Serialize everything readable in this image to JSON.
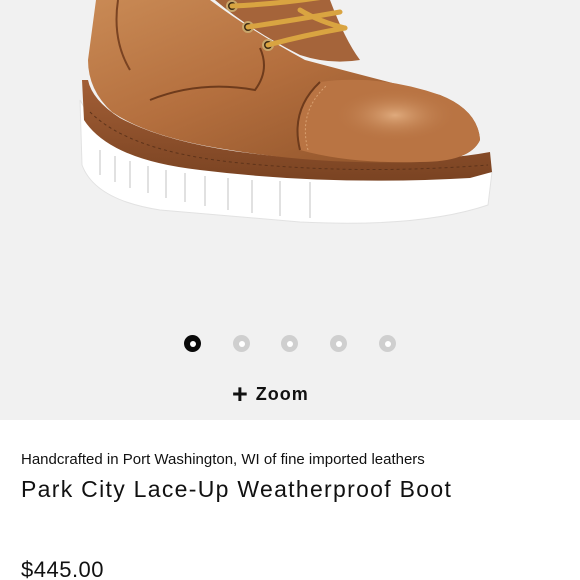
{
  "gallery": {
    "image_alt": "Park City Lace-Up Weatherproof Boot",
    "dots": [
      {
        "active": true
      },
      {
        "active": false
      },
      {
        "active": false
      },
      {
        "active": false
      },
      {
        "active": false
      }
    ],
    "zoom_icon": "plus-icon",
    "zoom_label": "Zoom"
  },
  "product": {
    "tagline": "Handcrafted in Port Washington, WI of fine imported leathers",
    "title": "Park City Lace-Up Weatherproof Boot",
    "price": "$445.00"
  },
  "colors": {
    "leather": "#b46f3e",
    "sole": "#ffffff",
    "lace": "#d9a441",
    "background": "#f1f1f1",
    "dot_active": "#0a0a0a",
    "dot_inactive": "#cfcfcf"
  }
}
